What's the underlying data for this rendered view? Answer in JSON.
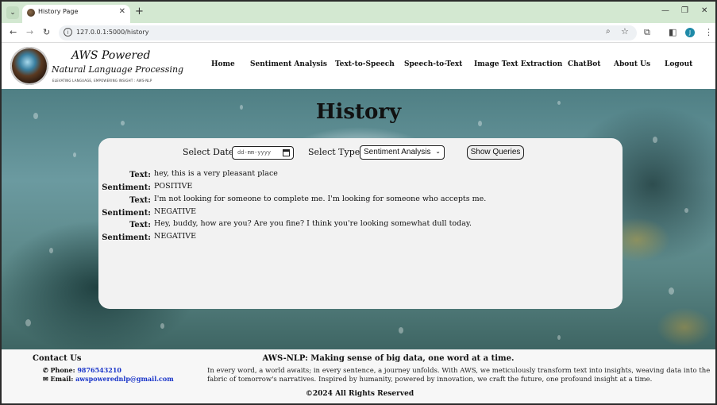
{
  "browser": {
    "tab_title": "History Page",
    "new_tab": "+",
    "url": "127.0.0.1:5000/history",
    "profile_initial": "J",
    "window_controls": {
      "minimize": "—",
      "restore": "❐",
      "close": "✕"
    }
  },
  "site": {
    "logo_title": "AWS Powered",
    "logo_subtitle": "Natural Language Processing",
    "logo_tagline": "ELEVATING LANGUAGE, EMPOWERING INSIGHT : AWS-NLP",
    "nav": [
      "Home",
      "Sentiment Analysis",
      "Text-to-Speech",
      "Speech-to-Text",
      "Image Text Extraction",
      "ChatBot",
      "About Us",
      "Logout"
    ]
  },
  "page": {
    "title": "History",
    "controls": {
      "date_label": "Select Date:",
      "date_placeholder": "dd-mm-yyyy",
      "type_label": "Select Type:",
      "type_value": "Sentiment Analysis",
      "show_button": "Show Queries"
    },
    "results": [
      {
        "text_label": "Text:",
        "text": "hey, this is a very pleasant place",
        "sentiment_label": "Sentiment:",
        "sentiment": "POSITIVE"
      },
      {
        "text_label": "Text:",
        "text": "I'm not looking for someone to complete me. I'm looking for someone who accepts me.",
        "sentiment_label": "Sentiment:",
        "sentiment": "NEGATIVE"
      },
      {
        "text_label": "Text:",
        "text": "Hey, buddy, how are you? Are you fine? I think you're looking somewhat dull today.",
        "sentiment_label": "Sentiment:",
        "sentiment": "NEGATIVE"
      }
    ]
  },
  "footer": {
    "contact_title": "Contact Us",
    "phone_label": "Phone:",
    "phone": "9876543210",
    "email_label": "Email:",
    "email": "awspowerednlp@gmail.com",
    "tagline": "AWS-NLP: Making sense of big data, one word at a time.",
    "about": "In every word, a world awaits; in every sentence, a journey unfolds. With AWS, we meticulously transform text into insights, weaving data into the fabric of tomorrow's narratives. Inspired by humanity, powered by innovation, we craft the future, one profound insight at a time.",
    "copyright": "©2024 All Rights Reserved"
  }
}
